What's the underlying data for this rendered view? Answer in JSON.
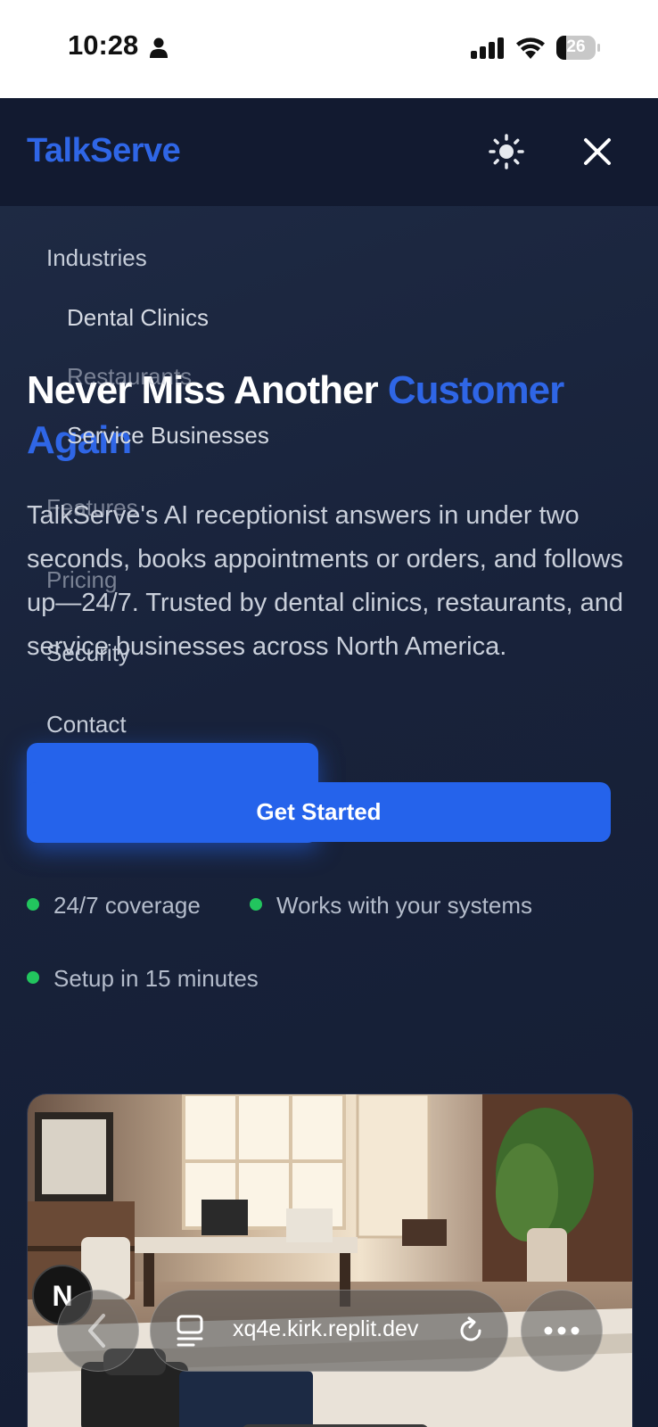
{
  "status_bar": {
    "time": "10:28",
    "battery": "26",
    "battery_level": 0.26,
    "icons": [
      "person-icon",
      "cellular-signal-icon",
      "wifi-icon",
      "battery-icon"
    ]
  },
  "nav": {
    "brand": "TalkServe",
    "theme_toggle_icon": "sun-icon",
    "close_icon": "close-icon"
  },
  "menu": {
    "items": [
      {
        "label": "Industries",
        "indent": false
      },
      {
        "label": "Dental Clinics",
        "indent": true
      },
      {
        "label": "Restaurants",
        "indent": true
      },
      {
        "label": "Service Businesses",
        "indent": true
      },
      {
        "label": "Features",
        "indent": false
      },
      {
        "label": "Pricing",
        "indent": false
      },
      {
        "label": "Security",
        "indent": false
      },
      {
        "label": "Contact",
        "indent": false
      }
    ]
  },
  "hero": {
    "title_main": "Never Miss Another ",
    "title_accent_1": "Customer",
    "title_accent_2": "Again",
    "description": "TalkServe's AI receptionist answers in under two seconds, books appointments or orders, and follows up—24/7. Trusted by dental clinics, restaurants, and service businesses across North America.",
    "cta_label": "Get Started",
    "features": [
      "24/7 coverage",
      "Works with your systems",
      "Setup in 15 minutes"
    ]
  },
  "floating_badge": "N",
  "browser": {
    "url": "xq4e.kirk.replit.dev",
    "back_icon": "chevron-left-icon",
    "tabs_icon": "tabs-icon",
    "reload_icon": "reload-icon",
    "more_icon": "more-icon"
  },
  "colors": {
    "accent": "#2563eb",
    "brand_blue": "#2f66e6",
    "success_dot": "#22c55e",
    "background": "#16213a"
  }
}
